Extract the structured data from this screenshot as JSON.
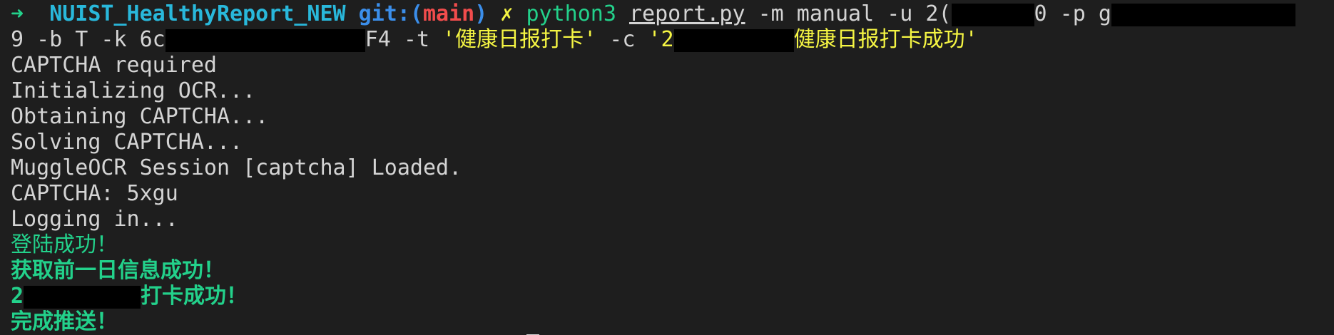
{
  "prompt": {
    "arrow": "➜",
    "directory": "NUIST_HealthyReport_NEW",
    "git_prefix": "git:(",
    "branch": "main",
    "git_suffix": ")",
    "dirty_mark": "✗"
  },
  "command": {
    "program": "python3",
    "script": "report.py",
    "seg1": " -m manual -u 2(",
    "seg2": "0 -p g",
    "line2_a": "9 -b T -k 6c",
    "line2_b": "F4 -t ",
    "title_arg": "'健康日报打卡'",
    "line2_c": " -c ",
    "content_arg_start": "'2",
    "content_arg_end": "健康日报打卡成功'"
  },
  "output": {
    "captcha_required": "CAPTCHA required",
    "init_ocr": "Initializing OCR...",
    "obtaining": "Obtaining CAPTCHA...",
    "solving": "Solving CAPTCHA...",
    "muggle": "MuggleOCR Session [captcha] Loaded.",
    "captcha_value": "CAPTCHA: 5xgu",
    "logging_in": "Logging in...",
    "login_success": "登陆成功！",
    "fetch_success": "获取前一日信息成功！",
    "report_prefix": "2",
    "report_success": "打卡成功！",
    "push_done": "完成推送！"
  },
  "colors": {
    "background": "#1e1e1e",
    "green": "#23d18b",
    "cyan": "#29b8db",
    "blue": "#3b8eea",
    "red": "#f14c4c",
    "yellow": "#f5f543",
    "foreground": "#d4d4d4",
    "redaction": "#000000"
  }
}
